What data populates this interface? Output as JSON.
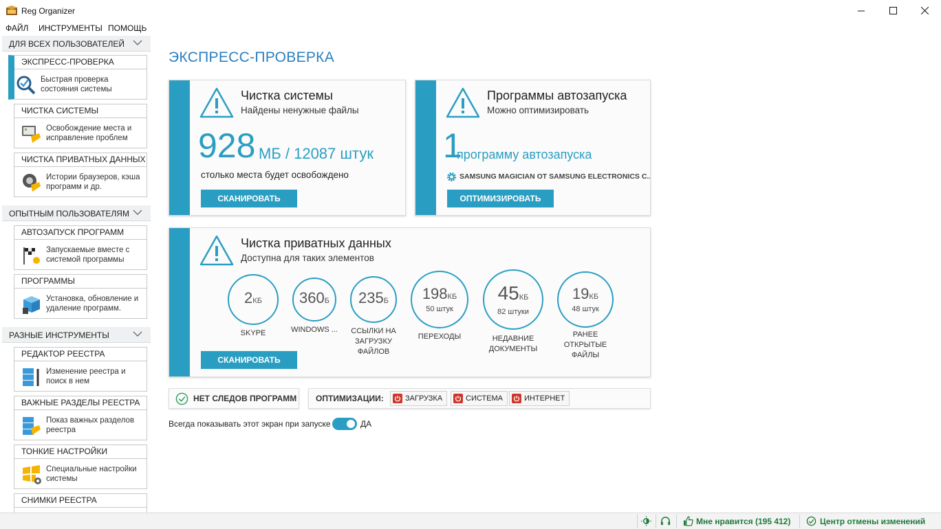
{
  "window": {
    "title": "Reg Organizer",
    "minimize": "—",
    "maximize": "☐",
    "close": "✕"
  },
  "menu": [
    "ФАЙЛ",
    "ИНСТРУМЕНТЫ",
    "ПОМОЩЬ"
  ],
  "sidebar": {
    "sections": [
      {
        "label": "ДЛЯ ВСЕХ ПОЛЬЗОВАТЕЛЕЙ"
      },
      {
        "label": "ОПЫТНЫМ ПОЛЬЗОВАТЕЛЯМ"
      },
      {
        "label": "РАЗНЫЕ ИНСТРУМЕНТЫ"
      }
    ],
    "items": [
      {
        "title": "ЭКСПРЕСС-ПРОВЕРКА",
        "desc": "Быстрая проверка состояния системы",
        "icon": "magnifier-check-icon",
        "active": true
      },
      {
        "title": "ЧИСТКА СИСТЕМЫ",
        "desc": "Освобождение места и исправление проблем",
        "icon": "system-cleanup-icon"
      },
      {
        "title": "ЧИСТКА ПРИВАТНЫХ ДАННЫХ",
        "desc": "Истории браузеров, кэша программ и др.",
        "icon": "privacy-cleanup-icon"
      },
      {
        "title": "АВТОЗАПУСК ПРОГРАММ",
        "desc": "Запускаемые вместе с системой программы",
        "icon": "startup-flag-icon"
      },
      {
        "title": "ПРОГРАММЫ",
        "desc": "Установка, обновление и удаление программ.",
        "icon": "programs-box-icon"
      },
      {
        "title": "РЕДАКТОР РЕЕСТРА",
        "desc": "Изменение реестра и поиск в нем",
        "icon": "registry-editor-icon"
      },
      {
        "title": "ВАЖНЫЕ РАЗДЕЛЫ РЕЕСТРА",
        "desc": "Показ важных разделов реестра",
        "icon": "registry-keys-icon"
      },
      {
        "title": "ТОНКИЕ НАСТРОЙКИ",
        "desc": "Специальные настройки системы",
        "icon": "windows-tweaks-icon"
      },
      {
        "title": "СНИМКИ РЕЕСТРА",
        "desc": "",
        "icon": "registry-snapshot-icon"
      }
    ]
  },
  "main": {
    "title": "ЭКСПРЕСС-ПРОВЕРКА",
    "cleanup": {
      "title": "Чистка системы",
      "subtitle": "Найдены ненужные файлы",
      "value": "928",
      "unit": "МБ / 12087 штук",
      "note": "столько места будет освобождено",
      "button": "СКАНИРОВАТЬ"
    },
    "startup": {
      "title": "Программы автозапуска",
      "subtitle": "Можно оптимизировать",
      "value": "1",
      "unit": "программу автозапуска",
      "item": "SAMSUNG MAGICIAN ОТ SAMSUNG ELECTRONICS C...",
      "button": "ОПТИМИЗИРОВАТЬ"
    },
    "privacy": {
      "title": "Чистка приватных данных",
      "subtitle": "Доступна для таких элементов",
      "button": "СКАНИРОВАТЬ",
      "items": [
        {
          "value": "2",
          "unit": "КБ",
          "count": "",
          "label": "SKYPE"
        },
        {
          "value": "360",
          "unit": "Б",
          "count": "",
          "label": "WINDOWS ..."
        },
        {
          "value": "235",
          "unit": "Б",
          "count": "",
          "label": "ССЫЛКИ НА ЗАГРУЗКУ ФАЙЛОВ"
        },
        {
          "value": "198",
          "unit": "КБ",
          "count": "50 штук",
          "label": "ПЕРЕХОДЫ"
        },
        {
          "value": "45",
          "unit": "КБ",
          "count": "82 штуки",
          "label": "НЕДАВНИЕ ДОКУМЕНТЫ"
        },
        {
          "value": "19",
          "unit": "КБ",
          "count": "48 штук",
          "label": "РАНЕЕ ОТКРЫТЫЕ ФАЙЛЫ"
        }
      ]
    },
    "no_traces": "НЕТ СЛЕДОВ ПРОГРАММ",
    "optimizations": {
      "label": "ОПТИМИЗАЦИИ:",
      "buttons": [
        "ЗАГРУЗКА",
        "СИСТЕМА",
        "ИНТЕРНЕТ"
      ]
    },
    "show_on_start": {
      "label": "Всегда показывать этот экран при запуске",
      "state": "ДА",
      "on": true
    }
  },
  "status": {
    "likes": "Мне нравится (195 412)",
    "undo_center": "Центр отмены изменений"
  },
  "colors": {
    "accent": "#2a9ec2",
    "title": "#2a7fbf",
    "status_green": "#1e7a3a",
    "red": "#d0352b"
  }
}
